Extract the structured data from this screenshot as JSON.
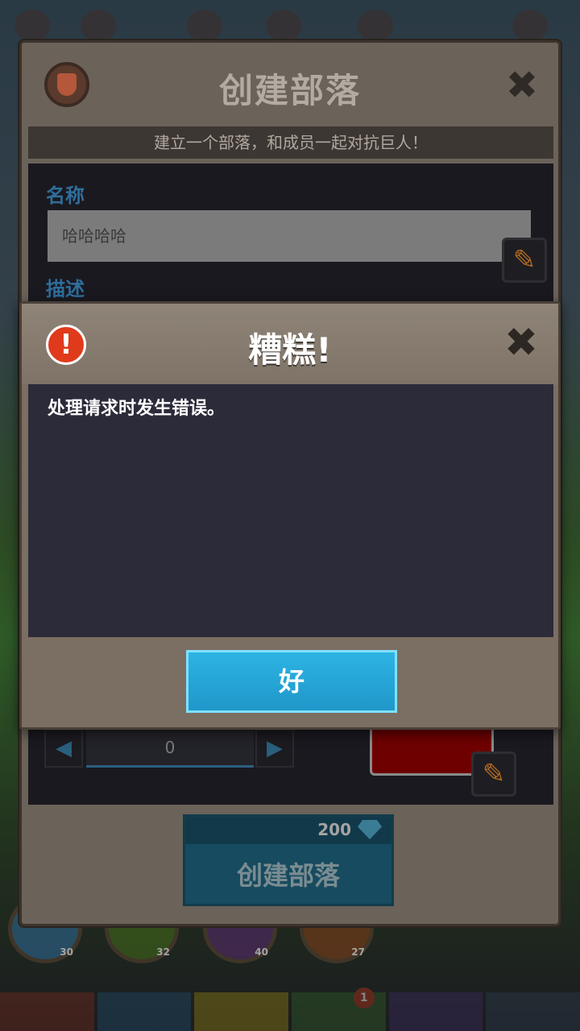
{
  "background": {
    "hero_levels": [
      "30",
      "32",
      "40",
      "27"
    ],
    "tab_badge_count": "1",
    "tab_colors": [
      "#6e2a1a",
      "#1f4a63",
      "#8a7a12",
      "#2f5a27",
      "#3a2a5a",
      "#2a3a4a"
    ]
  },
  "clan_panel": {
    "title": "创建部落",
    "subtitle": "建立一个部落，和成员一起对抗巨人！",
    "name_label": "名称",
    "name_value": "哈哈哈哈",
    "description_label": "描述",
    "stepper_value": "0",
    "stepper_prev": "◀",
    "stepper_next": "▶",
    "color_value": "#6e0000",
    "cost": "200",
    "create_button_label": "创建部落",
    "close_glyph": "✖",
    "edit_glyph": "✎"
  },
  "dialog": {
    "title": "糟糕!",
    "alert_glyph": "!",
    "message": "处理请求时发生错误。",
    "ok_label": "好",
    "close_glyph": "✖"
  }
}
